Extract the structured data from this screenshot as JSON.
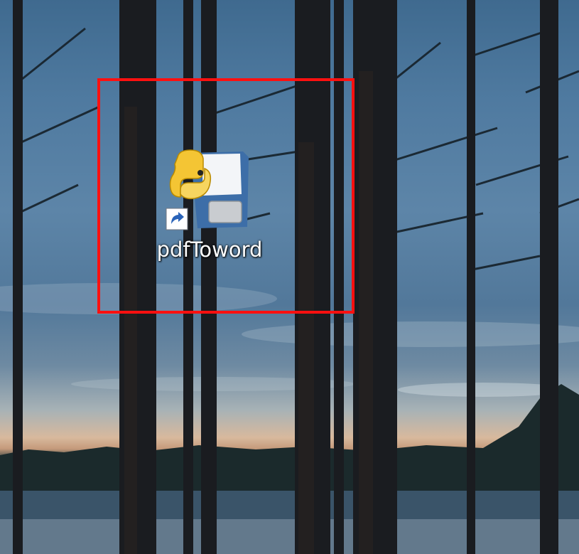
{
  "desktop": {
    "icons": [
      {
        "label": "pdfToword",
        "icon": "python-script-shortcut-icon",
        "shortcut_overlay": "shortcut-arrow-icon"
      }
    ]
  },
  "highlight": {
    "color": "#ff1010"
  }
}
